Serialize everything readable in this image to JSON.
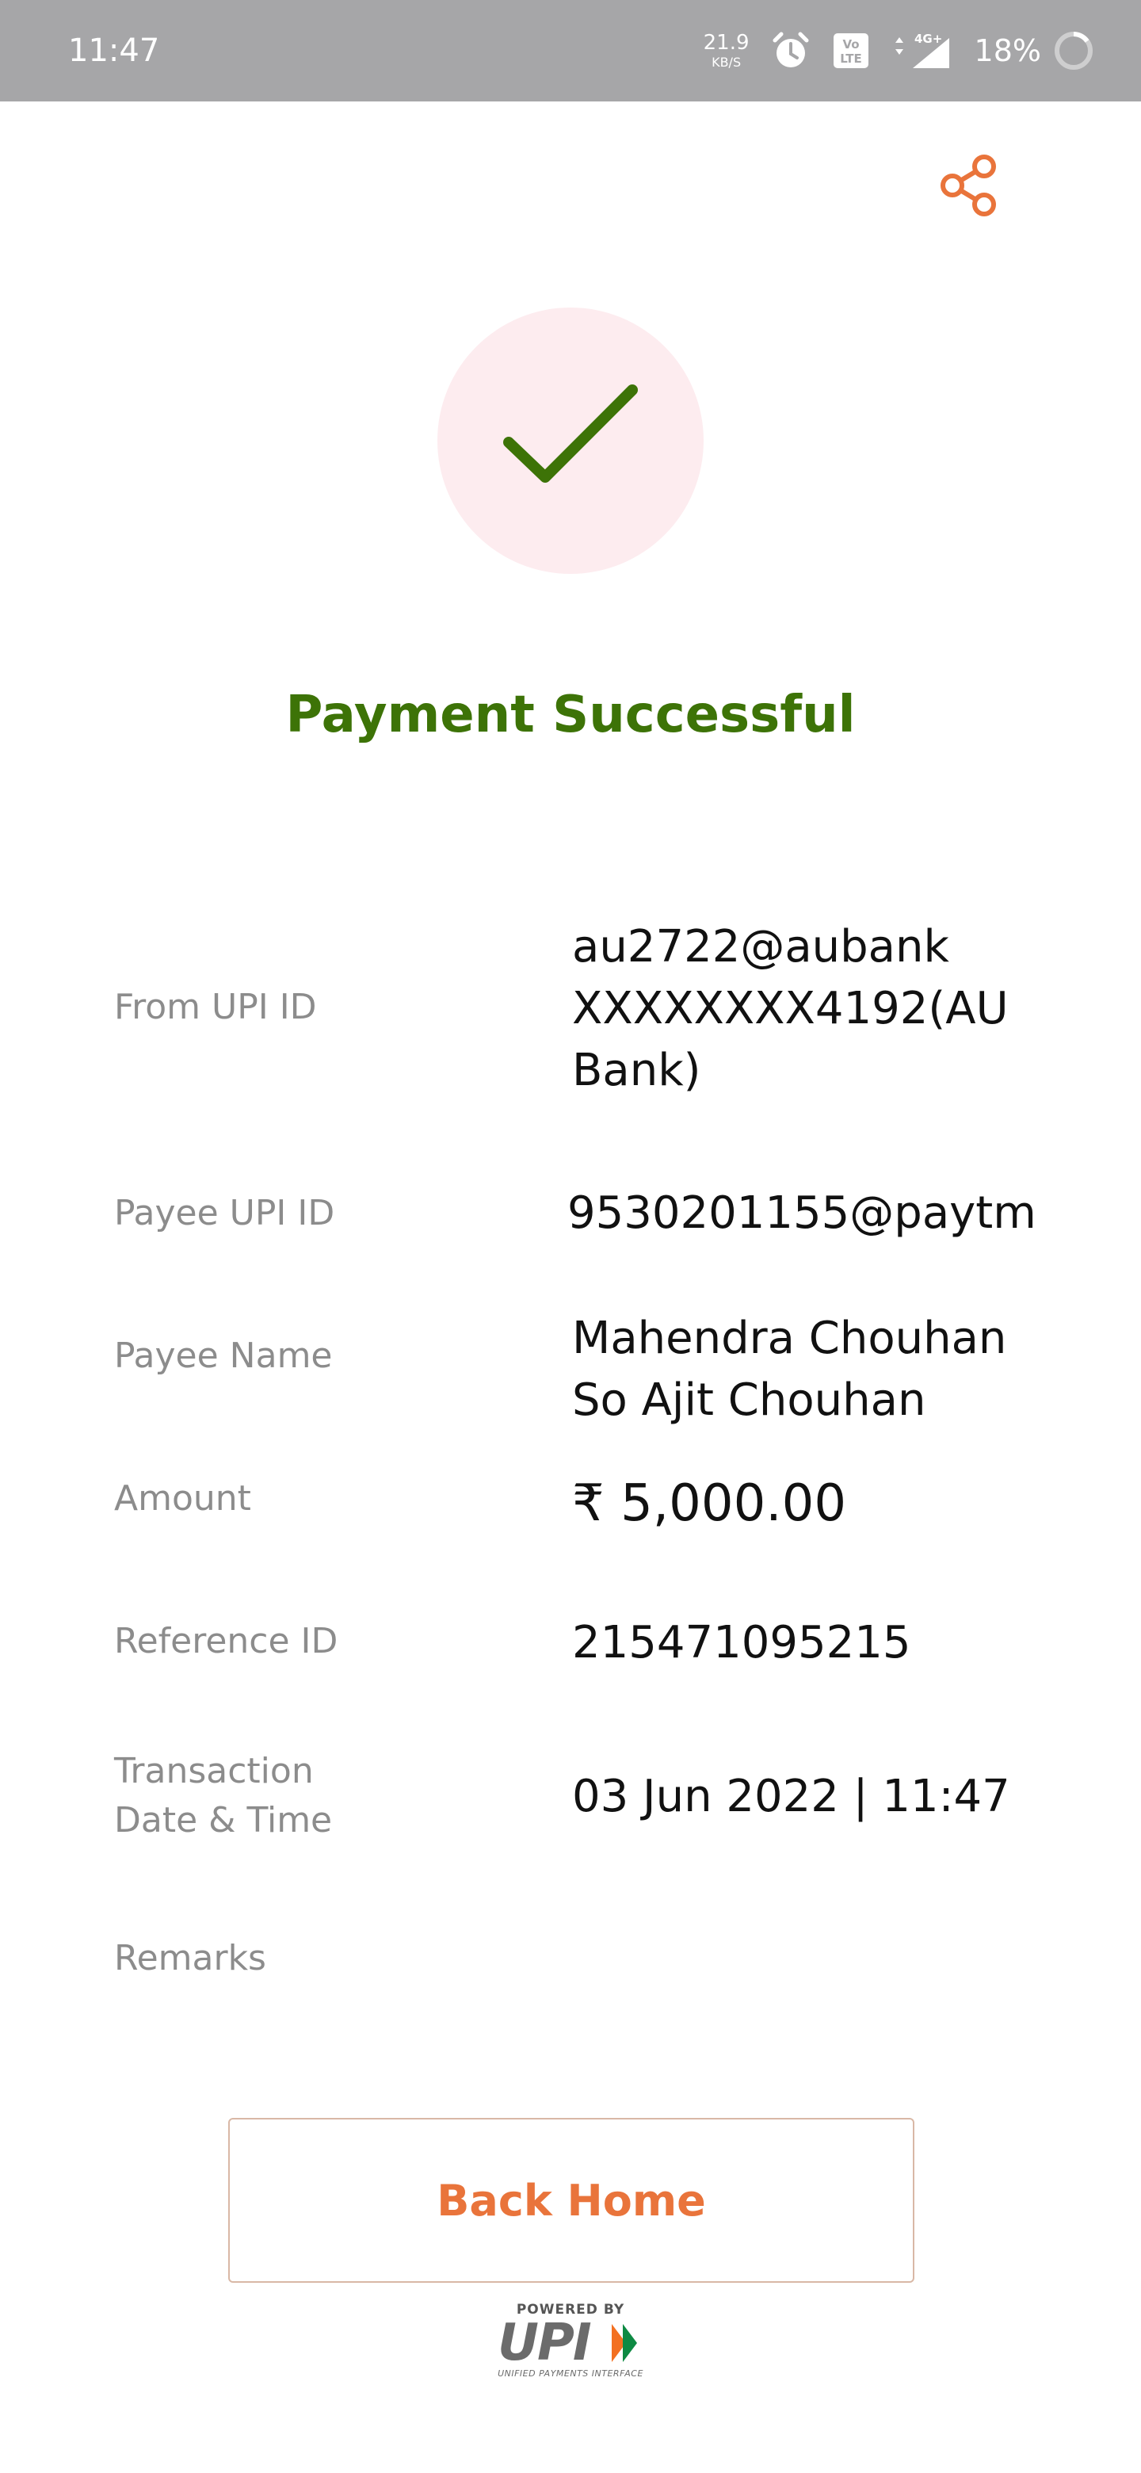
{
  "status_bar": {
    "time": "11:47",
    "net_speed": "21.9",
    "net_speed_unit": "KB/S",
    "signal_label": "4G+",
    "battery": "18%"
  },
  "result": {
    "title": "Payment Successful",
    "success_color": "#3d7307",
    "icon": "check-icon"
  },
  "details": {
    "from_upi_label": "From UPI ID",
    "from_upi_value": "au2722@aubank XXXXXXXX4192(AU Bank)",
    "payee_upi_label": "Payee UPI ID",
    "payee_upi_value": "9530201155@paytm",
    "payee_name_label": "Payee Name",
    "payee_name_value": "Mahendra Chouhan So Ajit Chouhan",
    "amount_label": "Amount",
    "amount_value": "₹ 5,000.00",
    "reference_label": "Reference ID",
    "reference_value": "215471095215",
    "datetime_label": "Transaction Date & Time",
    "datetime_value": "03 Jun 2022 | 11:47",
    "remarks_label": "Remarks",
    "remarks_value": ""
  },
  "actions": {
    "back_home": "Back Home",
    "accent_color": "#e9743b",
    "share_icon": "share-icon"
  },
  "footer": {
    "powered_by": "POWERED BY",
    "brand": "UPI",
    "brand_sub": "UNIFIED PAYMENTS INTERFACE"
  }
}
